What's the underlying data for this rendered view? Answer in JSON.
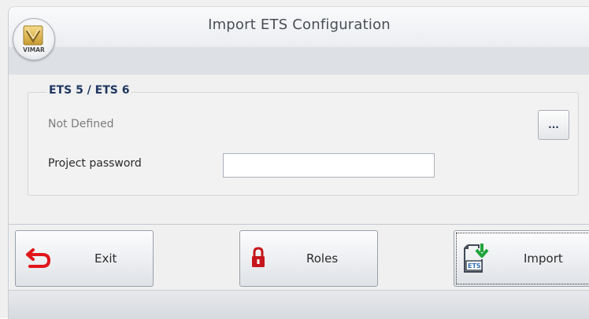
{
  "window": {
    "title": "Import ETS Configuration"
  },
  "logo": {
    "brand_text": "VIMAR",
    "icon": "vimar-logo-icon"
  },
  "group": {
    "title": "ETS 5 / ETS 6",
    "file_path": "Not Defined",
    "browse_label": "...",
    "password_label": "Project password",
    "password_value": ""
  },
  "buttons": {
    "exit": {
      "label": "Exit",
      "icon": "exit-arrow-icon",
      "color": "#e0161b"
    },
    "roles": {
      "label": "Roles",
      "icon": "padlock-icon",
      "color": "#c4161c"
    },
    "import": {
      "label": "Import",
      "icon": "ets-import-icon",
      "color": "#1fa43a"
    }
  },
  "colors": {
    "group_title": "#1f3660",
    "accent_green": "#1fa43a",
    "accent_red": "#e0161b"
  }
}
